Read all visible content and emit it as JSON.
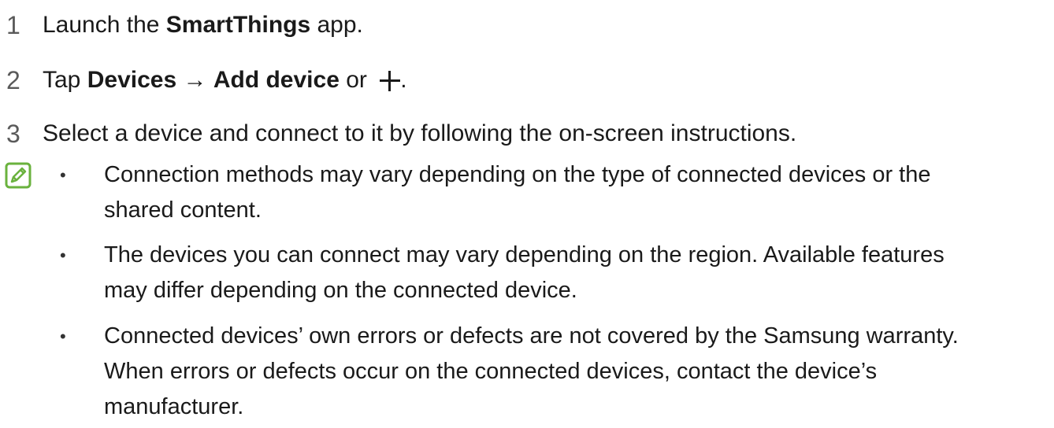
{
  "steps": [
    {
      "number": "1",
      "prefix": "Launch the ",
      "bold1": "SmartThings",
      "suffix": " app."
    },
    {
      "number": "2",
      "prefix": "Tap ",
      "bold1": "Devices",
      "arrow": " → ",
      "bold2": "Add device",
      "or_text": " or ",
      "end": "."
    },
    {
      "number": "3",
      "text": "Select a device and connect to it by following the on-screen instructions."
    }
  ],
  "note_icon": "note-pencil-icon",
  "accent_color": "#6ab23e",
  "bullets": [
    {
      "lines": [
        "Connection methods may vary depending on the type of connected devices or the",
        "shared content."
      ]
    },
    {
      "lines": [
        "The devices you can connect may vary depending on the region. Available features",
        "may differ depending on the connected device."
      ]
    },
    {
      "lines": [
        "Connected devices’ own errors or defects are not covered by the Samsung warranty.",
        "When errors or defects occur on the connected devices, contact the device’s",
        "manufacturer."
      ]
    }
  ],
  "bullet_symbol": "•"
}
